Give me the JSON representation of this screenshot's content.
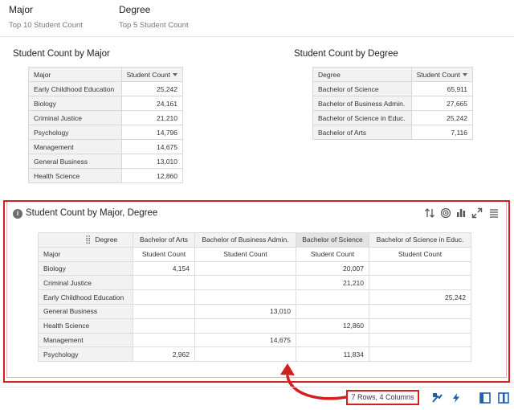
{
  "tabs": [
    {
      "title": "Major",
      "subtitle": "Top 10 Student Count"
    },
    {
      "title": "Degree",
      "subtitle": "Top 5 Student Count"
    }
  ],
  "major_table": {
    "title": "Student Count by Major",
    "col_label": "Major",
    "col_value": "Student Count",
    "rows": [
      {
        "label": "Early Childhood Education",
        "value": "25,242"
      },
      {
        "label": "Biology",
        "value": "24,161"
      },
      {
        "label": "Criminal Justice",
        "value": "21,210"
      },
      {
        "label": "Psychology",
        "value": "14,796"
      },
      {
        "label": "Management",
        "value": "14,675"
      },
      {
        "label": "General Business",
        "value": "13,010"
      },
      {
        "label": "Health Science",
        "value": "12,860"
      }
    ]
  },
  "degree_table": {
    "title": "Student Count by Degree",
    "col_label": "Degree",
    "col_value": "Student Count",
    "rows": [
      {
        "label": "Bachelor of Science",
        "value": "65,911"
      },
      {
        "label": "Bachelor of Business Admin.",
        "value": "27,665"
      },
      {
        "label": "Bachelor of Science in Educ.",
        "value": "25,242"
      },
      {
        "label": "Bachelor of Arts",
        "value": "7,116"
      }
    ]
  },
  "pivot": {
    "title": "Student Count by Major, Degree",
    "corner_label": "Degree",
    "row_header": "Major",
    "columns": [
      "Bachelor of Arts",
      "Bachelor of Business Admin.",
      "Bachelor of Science",
      "Bachelor of Science in Educ."
    ],
    "measure": "Student Count",
    "rows": [
      {
        "label": "Biology",
        "values": [
          "4,154",
          "",
          "20,007",
          ""
        ]
      },
      {
        "label": "Criminal Justice",
        "values": [
          "",
          "",
          "21,210",
          ""
        ]
      },
      {
        "label": "Early Childhood Education",
        "values": [
          "",
          "",
          "",
          "25,242"
        ]
      },
      {
        "label": "General Business",
        "values": [
          "",
          "13,010",
          "",
          ""
        ]
      },
      {
        "label": "Health Science",
        "values": [
          "",
          "",
          "12,860",
          ""
        ]
      },
      {
        "label": "Management",
        "values": [
          "",
          "14,675",
          "",
          ""
        ]
      },
      {
        "label": "Psychology",
        "values": [
          "2,962",
          "",
          "11,834",
          ""
        ]
      }
    ],
    "toolbar_icons": [
      "sort-icon",
      "target-icon",
      "bar-chart-icon",
      "expand-icon",
      "menu-icon"
    ]
  },
  "status": {
    "rows_columns": "7 Rows, 4 Columns"
  },
  "accent_color": "#d21f1f",
  "icon_blue": "#1f5fae"
}
